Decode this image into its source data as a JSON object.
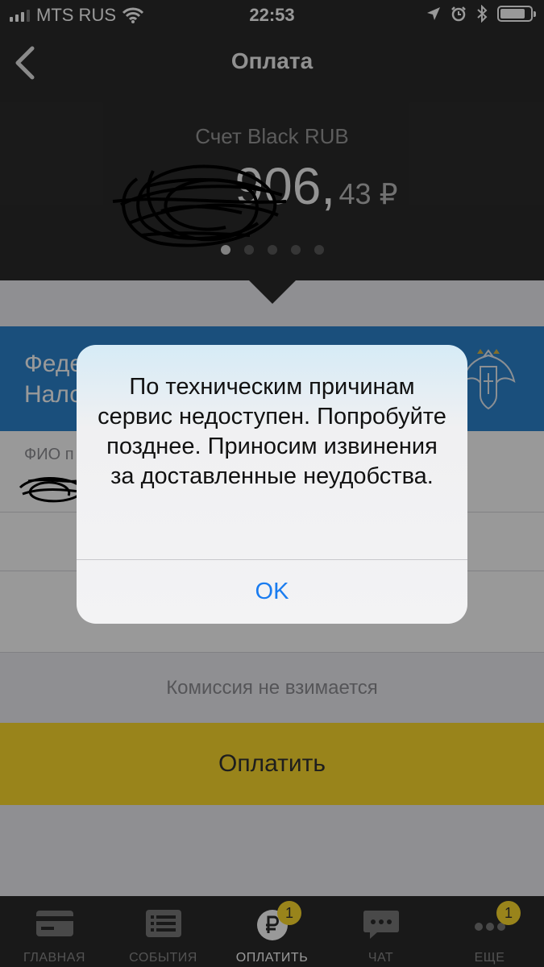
{
  "status_bar": {
    "carrier": "MTS RUS",
    "time": "22:53"
  },
  "header": {
    "title": "Оплата",
    "account_name": "Счет Black RUB",
    "balance_int": "906,",
    "balance_frac": "43 ₽",
    "page_count": 5,
    "active_page": 1
  },
  "payee": {
    "name": "Феде\nНало"
  },
  "form": {
    "fio_label": "ФИО п",
    "commission_text": "Комиссия не взимается",
    "pay_button_label": "Оплатить"
  },
  "alert": {
    "message": "По техническим причинам сервис недоступен. Попробуйте позднее. Приносим извинения за доставленные неудобства.",
    "ok_label": "OK"
  },
  "tabbar": {
    "tabs": [
      {
        "label": "ГЛАВНАЯ",
        "icon": "card-icon"
      },
      {
        "label": "СОБЫТИЯ",
        "icon": "list-icon"
      },
      {
        "label": "ОПЛАТИТЬ",
        "icon": "ruble-icon",
        "badge": "1",
        "active": true
      },
      {
        "label": "ЧАТ",
        "icon": "chat-icon"
      },
      {
        "label": "ЕЩЕ",
        "icon": "more-icon",
        "badge": "1"
      }
    ]
  },
  "colors": {
    "dark": "#2b2b2b",
    "accent_yellow": "#ffdd2d",
    "banner_blue": "#2c84cf",
    "ios_blue": "#1a7cf0"
  }
}
